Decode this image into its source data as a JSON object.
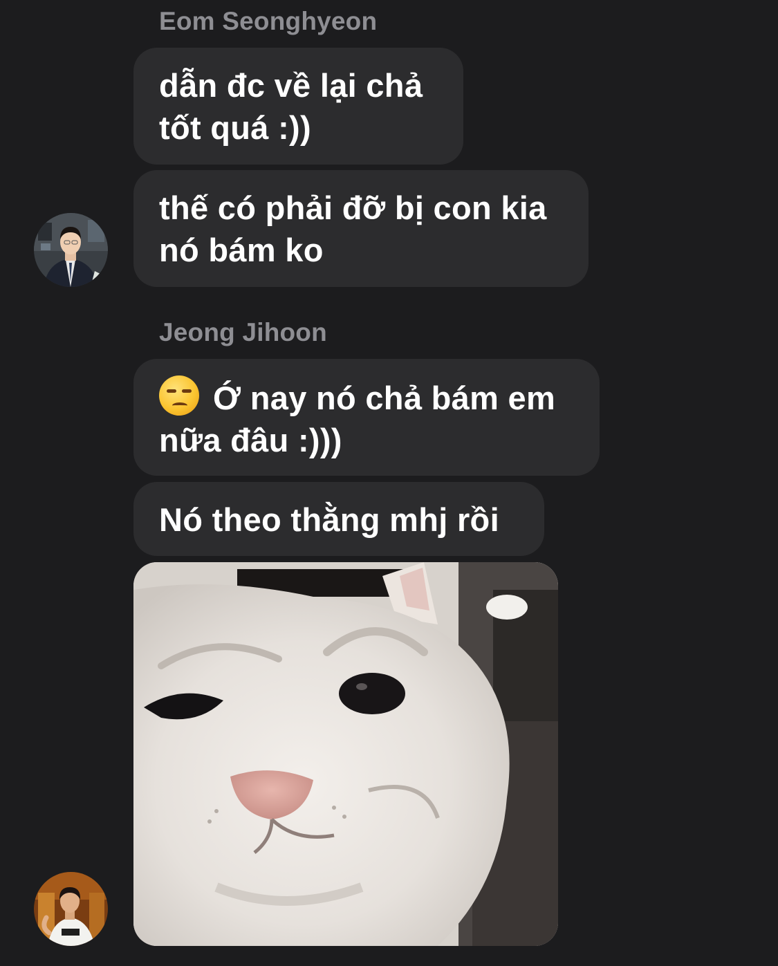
{
  "conversation": {
    "groups": [
      {
        "sender": "Eom Seonghyeon",
        "messages": [
          {
            "lines": [
              "dẫn đc về lại chả",
              "tốt quá :))"
            ]
          },
          {
            "lines": [
              "thế có phải đỡ bị con kia",
              "nó bám ko"
            ]
          }
        ]
      },
      {
        "sender": "Jeong Jihoon",
        "messages": [
          {
            "emoji": "unamused-face-emoji",
            "lines": [
              "Ớ nay nó chả bám em",
              "nữa đâu :)))"
            ]
          },
          {
            "lines": [
              "Nó theo thằng mhj rồi"
            ]
          },
          {
            "image": "smirking-white-cat-meme"
          }
        ]
      }
    ]
  },
  "colors": {
    "background": "#1c1c1e",
    "bubble": "#2c2c2e",
    "sender_name": "#8e8e93",
    "message_text": "#ffffff"
  }
}
